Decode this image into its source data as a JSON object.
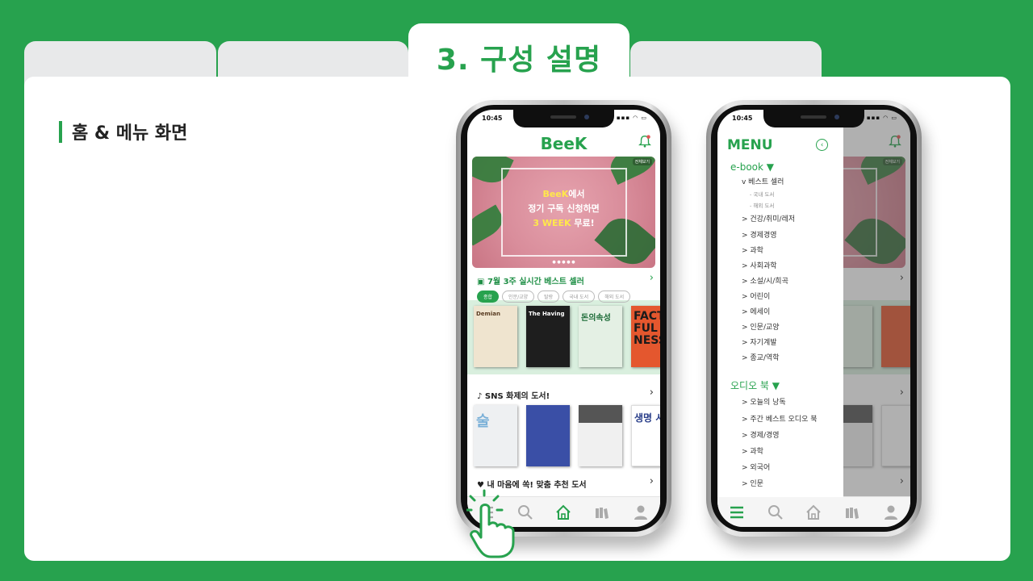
{
  "slide": {
    "tabs": [
      "",
      "",
      "3. 구성 설명",
      ""
    ],
    "active_tab": "3. 구성 설명",
    "heading": "홈 & 메뉴 화면"
  },
  "phone": {
    "time": "10:45",
    "indicators": "▪▪▪ ◠ ▭",
    "logo": "BeeK",
    "banner": {
      "more": "전체보기",
      "line1_brand": "BeeK",
      "line1_rest": "에서",
      "line2": "정기 구독 신청하면",
      "line3_week": "3 WEEK",
      "line3_rest": " 무료!",
      "dots": "● ● ● ● ●"
    },
    "bestseller_title": "7월 3주 실시간 베스트 셀러",
    "chips": [
      "종합",
      "인문/교양",
      "탈랑",
      "국내 도서",
      "해외 도서"
    ],
    "bestseller_books": [
      {
        "title": "Demian",
        "bg": "#efe4cf",
        "fg": "#5a3d24"
      },
      {
        "title": "The Having",
        "bg": "#1e1e1e",
        "fg": "#ffffff"
      },
      {
        "title": "돈의속성",
        "bg": "#e4f0e4",
        "fg": "#1c6b37"
      },
      {
        "title": "FACT FUL NESS",
        "bg": "#e4572e",
        "fg": "#1b1b1b"
      }
    ],
    "sns_title": "SNS 화제의 도서!",
    "sns_books": [
      {
        "title": "술",
        "bg": "#eef0f2",
        "fg": "#7ab0d8"
      },
      {
        "title": "",
        "bg": "#3a4fa6",
        "fg": "#ffffff"
      },
      {
        "title": "",
        "bg": "#f0f0f0",
        "fg": "#333333"
      },
      {
        "title": "생명 시간",
        "bg": "#ffffff",
        "fg": "#2a3f8a"
      }
    ],
    "recommend_title": "내 마음에 쏙! 맞춤 추천 도서"
  },
  "menu": {
    "title": "MENU",
    "ebook": {
      "label": "e-book ▼",
      "best": "v 베스트 셀러",
      "best_subs": [
        "- 국내 도서",
        "- 해외 도서"
      ],
      "items": [
        "> 건강/취미/레저",
        "> 경제경영",
        "> 과학",
        "> 사회과학",
        "> 소설/시/희곡",
        "> 어린이",
        "> 에세이",
        "> 인문/교양",
        "> 자기계발",
        "> 종교/역학"
      ]
    },
    "audio": {
      "label": "오디오 북 ▼",
      "items": [
        "> 오늘의 낭독",
        "> 주간 베스트 오디오 북",
        "> 경제/경영",
        "> 과학",
        "> 외국어",
        "> 인문"
      ]
    }
  },
  "colors": {
    "brand": "#27a24e",
    "tab_inactive": "#e8e9ea"
  }
}
